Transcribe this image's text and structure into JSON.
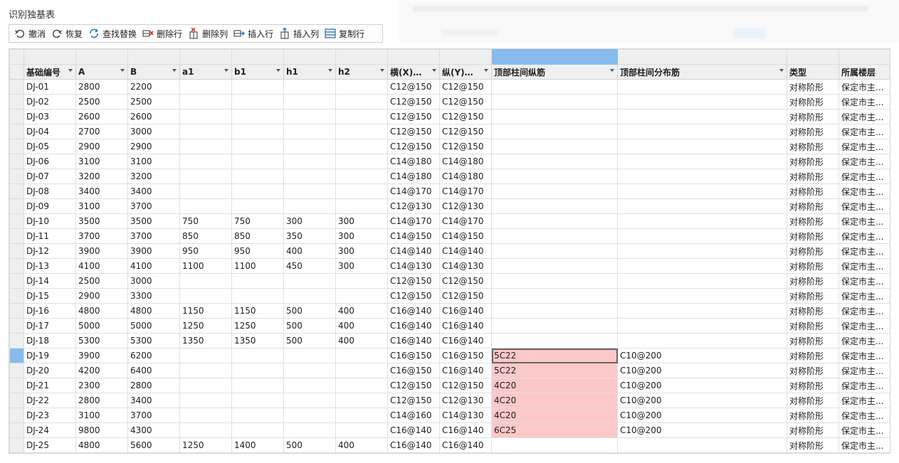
{
  "dialog": {
    "title": "识别独基表"
  },
  "toolbar": [
    {
      "name": "undo-button",
      "icon": "undo-icon",
      "label": "撤消"
    },
    {
      "name": "redo-button",
      "icon": "redo-icon",
      "label": "恢复"
    },
    {
      "name": "find-replace-button",
      "icon": "refresh-icon",
      "label": "查找替换"
    },
    {
      "name": "delete-row-button",
      "icon": "delete-row-icon",
      "label": "删除行"
    },
    {
      "name": "delete-column-button",
      "icon": "delete-column-icon",
      "label": "删除列"
    },
    {
      "name": "insert-row-button",
      "icon": "insert-row-icon",
      "label": "插入行"
    },
    {
      "name": "insert-column-button",
      "icon": "insert-column-icon",
      "label": "插入列"
    },
    {
      "name": "copy-row-button",
      "icon": "copy-row-icon",
      "label": "复制行"
    }
  ],
  "colors": {
    "selection": "#88bbee",
    "highlight": "#fcc8c8",
    "header": "#efefef"
  },
  "grid": {
    "columns": [
      "基础编号",
      "A",
      "B",
      "a1",
      "b1",
      "h1",
      "h2",
      "横(X)向...",
      "纵(Y)向...",
      "顶部柱间纵筋",
      "顶部柱间分布筋",
      "类型",
      "所属楼层"
    ],
    "rows": [
      [
        "DJ-01",
        "2800",
        "2200",
        "",
        "",
        "",
        "",
        "C12@150",
        "C12@150",
        "",
        "",
        "对称阶形",
        "保定市主..."
      ],
      [
        "DJ-02",
        "2500",
        "2500",
        "",
        "",
        "",
        "",
        "C12@150",
        "C12@150",
        "",
        "",
        "对称阶形",
        "保定市主..."
      ],
      [
        "DJ-03",
        "2600",
        "2600",
        "",
        "",
        "",
        "",
        "C12@150",
        "C12@150",
        "",
        "",
        "对称阶形",
        "保定市主..."
      ],
      [
        "DJ-04",
        "2700",
        "3000",
        "",
        "",
        "",
        "",
        "C12@150",
        "C12@150",
        "",
        "",
        "对称阶形",
        "保定市主..."
      ],
      [
        "DJ-05",
        "2900",
        "2900",
        "",
        "",
        "",
        "",
        "C12@150",
        "C12@150",
        "",
        "",
        "对称阶形",
        "保定市主..."
      ],
      [
        "DJ-06",
        "3100",
        "3100",
        "",
        "",
        "",
        "",
        "C14@180",
        "C14@180",
        "",
        "",
        "对称阶形",
        "保定市主..."
      ],
      [
        "DJ-07",
        "3200",
        "3200",
        "",
        "",
        "",
        "",
        "C14@180",
        "C14@180",
        "",
        "",
        "对称阶形",
        "保定市主..."
      ],
      [
        "DJ-08",
        "3400",
        "3400",
        "",
        "",
        "",
        "",
        "C14@170",
        "C14@170",
        "",
        "",
        "对称阶形",
        "保定市主..."
      ],
      [
        "DJ-09",
        "3100",
        "3700",
        "",
        "",
        "",
        "",
        "C12@130",
        "C12@130",
        "",
        "",
        "对称阶形",
        "保定市主..."
      ],
      [
        "DJ-10",
        "3500",
        "3500",
        "750",
        "750",
        "300",
        "300",
        "C14@170",
        "C14@170",
        "",
        "",
        "对称阶形",
        "保定市主..."
      ],
      [
        "DJ-11",
        "3700",
        "3700",
        "850",
        "850",
        "350",
        "300",
        "C14@150",
        "C14@150",
        "",
        "",
        "对称阶形",
        "保定市主..."
      ],
      [
        "DJ-12",
        "3900",
        "3900",
        "950",
        "950",
        "400",
        "300",
        "C14@140",
        "C14@140",
        "",
        "",
        "对称阶形",
        "保定市主..."
      ],
      [
        "DJ-13",
        "4100",
        "4100",
        "1100",
        "1100",
        "450",
        "300",
        "C14@130",
        "C14@130",
        "",
        "",
        "对称阶形",
        "保定市主..."
      ],
      [
        "DJ-14",
        "2500",
        "3000",
        "",
        "",
        "",
        "",
        "C12@150",
        "C12@150",
        "",
        "",
        "对称阶形",
        "保定市主..."
      ],
      [
        "DJ-15",
        "2900",
        "3300",
        "",
        "",
        "",
        "",
        "C12@150",
        "C12@150",
        "",
        "",
        "对称阶形",
        "保定市主..."
      ],
      [
        "DJ-16",
        "4800",
        "4800",
        "1150",
        "1150",
        "500",
        "400",
        "C16@140",
        "C16@140",
        "",
        "",
        "对称阶形",
        "保定市主..."
      ],
      [
        "DJ-17",
        "5000",
        "5000",
        "1250",
        "1250",
        "500",
        "400",
        "C16@140",
        "C16@140",
        "",
        "",
        "对称阶形",
        "保定市主..."
      ],
      [
        "DJ-18",
        "5300",
        "5300",
        "1350",
        "1350",
        "500",
        "400",
        "C16@140",
        "C16@140",
        "",
        "",
        "对称阶形",
        "保定市主..."
      ],
      [
        "DJ-19",
        "3900",
        "6200",
        "",
        "",
        "",
        "",
        "C16@150",
        "C16@150",
        "5C22",
        "C10@200",
        "对称阶形",
        "保定市主..."
      ],
      [
        "DJ-20",
        "4200",
        "6400",
        "",
        "",
        "",
        "",
        "C16@150",
        "C16@140",
        "5C22",
        "C10@200",
        "对称阶形",
        "保定市主..."
      ],
      [
        "DJ-21",
        "2300",
        "2800",
        "",
        "",
        "",
        "",
        "C12@150",
        "C12@150",
        "4C20",
        "C10@200",
        "对称阶形",
        "保定市主..."
      ],
      [
        "DJ-22",
        "2800",
        "3400",
        "",
        "",
        "",
        "",
        "C12@150",
        "C12@130",
        "4C20",
        "C10@200",
        "对称阶形",
        "保定市主..."
      ],
      [
        "DJ-23",
        "3100",
        "3700",
        "",
        "",
        "",
        "",
        "C14@160",
        "C14@130",
        "4C20",
        "C10@200",
        "对称阶形",
        "保定市主..."
      ],
      [
        "DJ-24",
        "9800",
        "4300",
        "",
        "",
        "",
        "",
        "C16@140",
        "C16@140",
        "6C25",
        "C10@200",
        "对称阶形",
        "保定市主..."
      ],
      [
        "DJ-25",
        "4800",
        "5600",
        "1250",
        "1400",
        "500",
        "400",
        "C16@140",
        "C16@140",
        "",
        "",
        "对称阶形",
        "保定市主..."
      ]
    ],
    "highlighted_column": 9,
    "highlighted_rows": [
      18,
      19,
      20,
      21,
      22,
      23
    ],
    "active_row": 18,
    "selected_column": 9
  }
}
